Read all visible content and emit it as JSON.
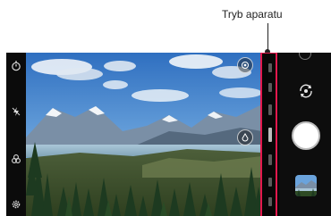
{
  "callout": {
    "label": "Tryb aparatu"
  },
  "left_bar": {
    "icons": [
      "timer-icon",
      "flash-off-icon",
      "cine-mode-icon",
      "settings-icon"
    ]
  },
  "viewfinder": {
    "icons": [
      "lens-switch-icon",
      "focus-icon"
    ]
  },
  "mode_strip": {
    "highlight_color": "#e3184d"
  },
  "right_bar": {
    "icons": [
      "camera-flip-icon",
      "shutter-button",
      "gallery-thumbnail"
    ]
  }
}
